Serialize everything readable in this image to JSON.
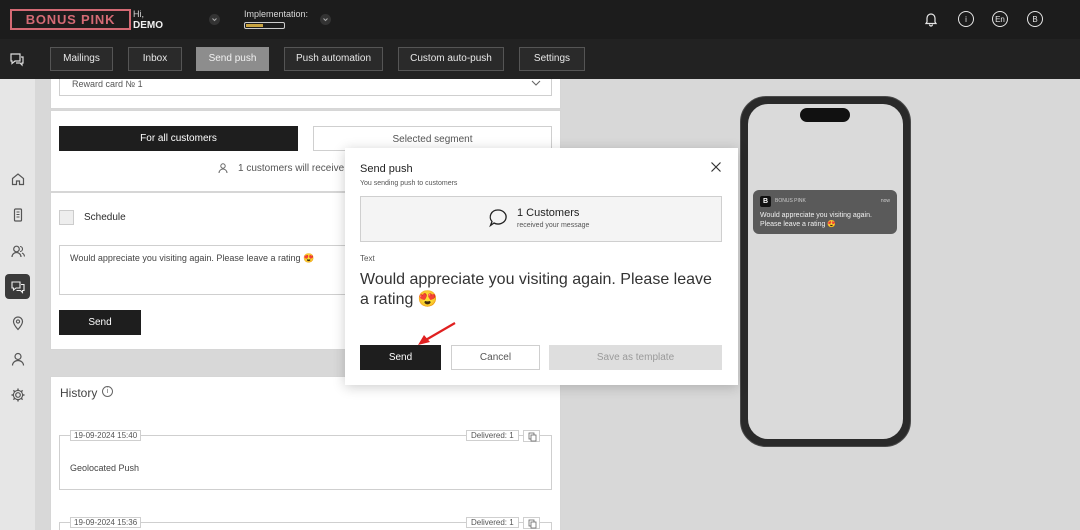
{
  "brand": {
    "logo": "BONUS PINK",
    "accent": "#d46a74"
  },
  "user": {
    "greeting": "Hi,",
    "name": "DEMO"
  },
  "implementation": {
    "label": "Implementation:",
    "progress_pct": 45
  },
  "top_icons": {
    "bell": "bell-icon",
    "info_glyph": "i",
    "lang": "En",
    "avatar": "B"
  },
  "nav": {
    "tabs": [
      {
        "label": "Mailings"
      },
      {
        "label": "Inbox"
      },
      {
        "label": "Send push",
        "active": true
      },
      {
        "label": "Push automation"
      },
      {
        "label": "Custom auto-push"
      },
      {
        "label": "Settings"
      }
    ]
  },
  "sidebar": {
    "icons": [
      "chat-icon",
      "home-icon",
      "phone-card-icon",
      "customers-icon",
      "push-icon",
      "location-icon",
      "user-icon",
      "gear-icon"
    ]
  },
  "form": {
    "card_select_value": "Reward card № 1",
    "for_all_label": "For all customers",
    "selected_segment_label": "Selected segment",
    "customers_notice": "1 customers will receive yo",
    "schedule_label": "Schedule",
    "message": "Would appreciate you visiting again. Please leave a rating 😍",
    "send_label": "Send"
  },
  "history": {
    "title": "History",
    "info_glyph": "i",
    "items": [
      {
        "date": "19-09-2024 15:40",
        "delivered": "Delivered: 1",
        "text": "Geolocated Push"
      },
      {
        "date": "19-09-2024 15:36",
        "delivered": "Delivered: 1",
        "text": ""
      }
    ]
  },
  "preview": {
    "app_logo": "B",
    "app_name": "BONUS PINK",
    "time": "now",
    "text": "Would appreciate you visiting again. Please leave a rating 😍"
  },
  "modal": {
    "title": "Send push",
    "subtitle": "You sending push to customers",
    "count_title": "1 Customers",
    "count_sub": "received your message",
    "text_label": "Text",
    "text": "Would appreciate you visiting again. Please leave a rating 😍",
    "send_label": "Send",
    "cancel_label": "Cancel",
    "save_template_label": "Save as template"
  }
}
